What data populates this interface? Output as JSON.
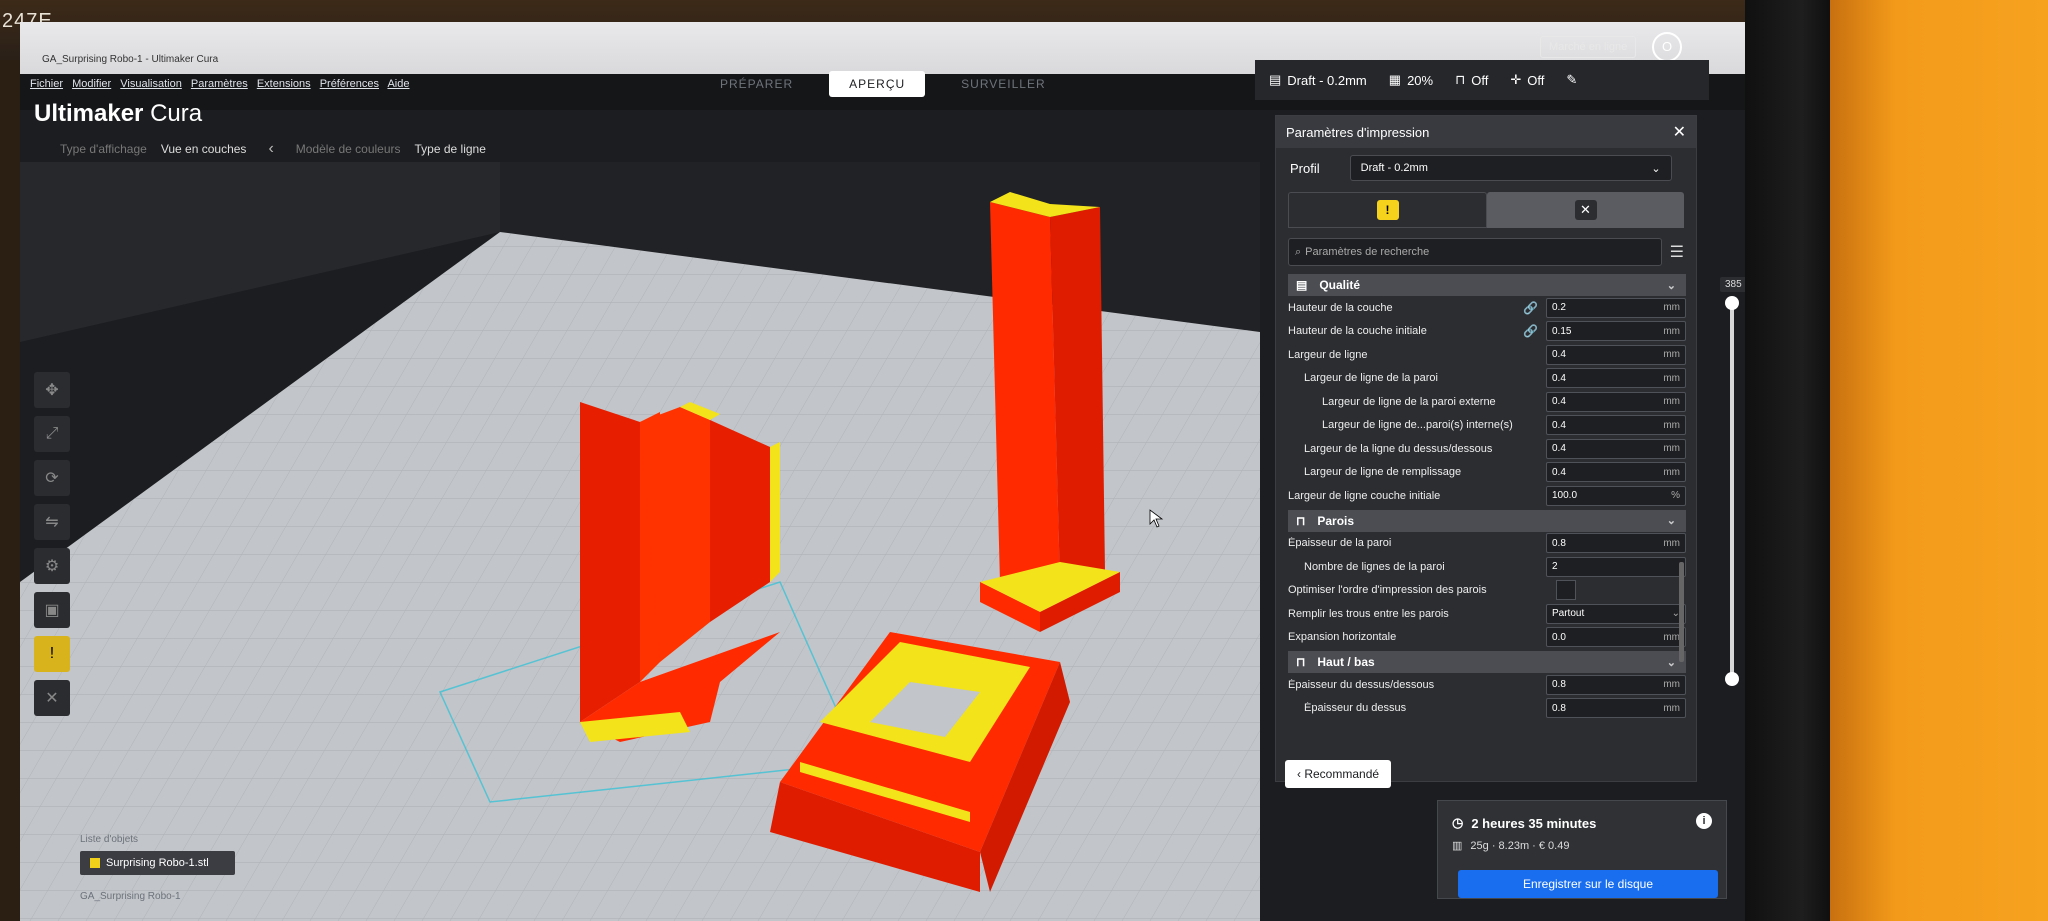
{
  "photo": {
    "corner_text": "247E"
  },
  "window": {
    "title": "GA_Surprising Robo-1 - Ultimaker Cura"
  },
  "menu": {
    "items": [
      "Fichier",
      "Modifier",
      "Visualisation",
      "Paramètres",
      "Extensions",
      "Préférences",
      "Aide"
    ]
  },
  "stages": {
    "prepare": "PRÉPARER",
    "preview": "APERÇU",
    "monitor": "SURVEILLER"
  },
  "header": {
    "marketplace": "Marché en ligne",
    "account": "O"
  },
  "brand": {
    "bold": "Ultimaker",
    "light": "Cura"
  },
  "view": {
    "view_type_label": "Type d'affichage",
    "view_type_value": "Vue en couches",
    "color_scheme_label": "Modèle de couleurs",
    "color_scheme_value": "Type de ligne"
  },
  "objects": {
    "header": "Liste d'objets",
    "item": "Surprising Robo-1.stl",
    "footer": "GA_Surprising Robo-1"
  },
  "setup_bar": {
    "profile": "Draft - 0.2mm",
    "infill": "20%",
    "support": "Off",
    "adhesion": "Off"
  },
  "panel": {
    "title": "Paramètres d'impression",
    "profile_label": "Profil",
    "profile_value": "Draft - 0.2mm",
    "search_placeholder": "Paramètres de recherche",
    "recommended": "Recommandé"
  },
  "quality": {
    "title": "Qualité",
    "rows": [
      {
        "label": "Hauteur de la couche",
        "value": "0.2",
        "unit": "mm"
      },
      {
        "label": "Hauteur de la couche initiale",
        "value": "0.15",
        "unit": "mm"
      },
      {
        "label": "Largeur de ligne",
        "value": "0.4",
        "unit": "mm"
      },
      {
        "label": "Largeur de ligne de la paroi",
        "value": "0.4",
        "unit": "mm"
      },
      {
        "label": "Largeur de ligne de la paroi externe",
        "value": "0.4",
        "unit": "mm"
      },
      {
        "label": "Largeur de ligne de...paroi(s) interne(s)",
        "value": "0.4",
        "unit": "mm"
      },
      {
        "label": "Largeur de la ligne du dessus/dessous",
        "value": "0.4",
        "unit": "mm"
      },
      {
        "label": "Largeur de ligne de remplissage",
        "value": "0.4",
        "unit": "mm"
      },
      {
        "label": "Largeur de ligne couche initiale",
        "value": "100.0",
        "unit": "%"
      }
    ]
  },
  "walls": {
    "title": "Parois",
    "rows": [
      {
        "label": "Épaisseur de la paroi",
        "value": "0.8",
        "unit": "mm"
      },
      {
        "label": "Nombre de lignes de la paroi",
        "value": "2",
        "unit": ""
      },
      {
        "label": "Optimiser l'ordre d'impression des parois"
      },
      {
        "label": "Remplir les trous entre les parois",
        "value": "Partout",
        "unit": ""
      },
      {
        "label": "Expansion horizontale",
        "value": "0.0",
        "unit": "mm"
      }
    ]
  },
  "topbottom": {
    "title": "Haut / bas",
    "rows": [
      {
        "label": "Épaisseur du dessus/dessous",
        "value": "0.8",
        "unit": "mm"
      },
      {
        "label": "Épaisseur du dessus",
        "value": "0.8",
        "unit": "mm"
      }
    ]
  },
  "layer": {
    "top_value": "385"
  },
  "print_info": {
    "time": "2 heures 35 minutes",
    "material": "25g · 8.23m · € 0.49",
    "save": "Enregistrer sur le disque"
  },
  "colors": {
    "accent": "#196ef0",
    "model": "#ff2a00",
    "infill": "#f2e31b"
  }
}
